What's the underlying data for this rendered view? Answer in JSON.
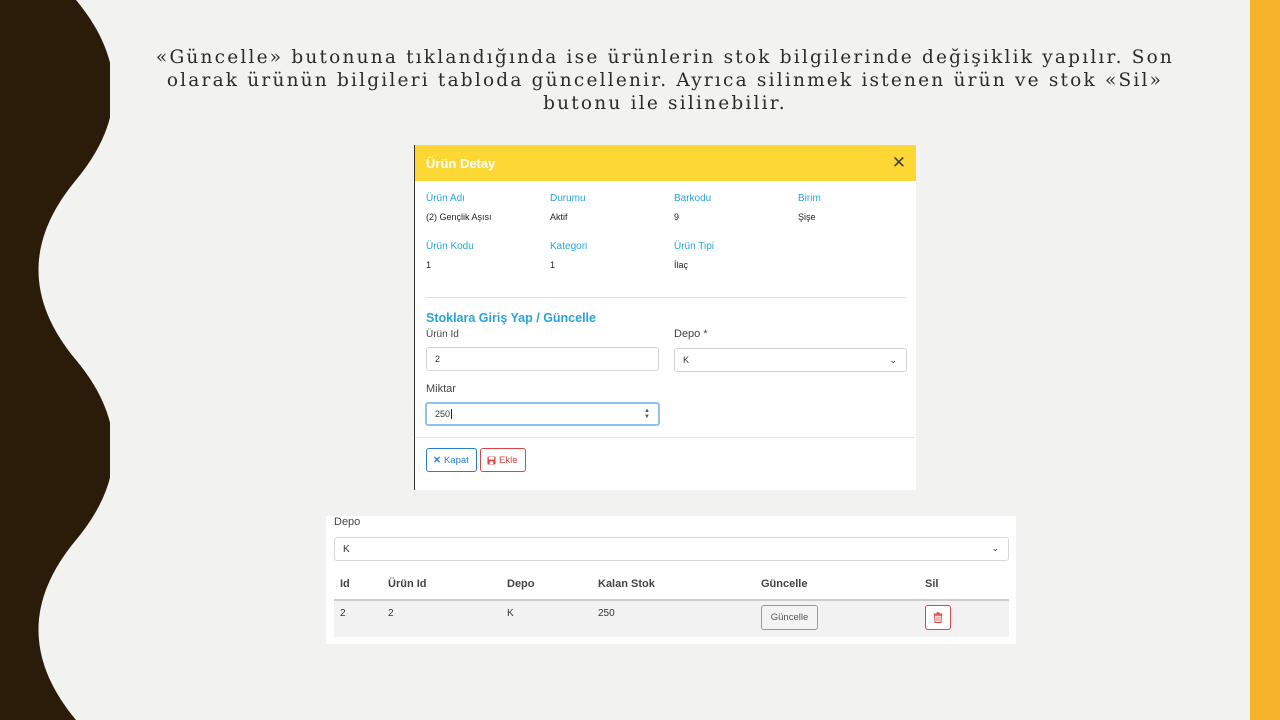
{
  "slide": {
    "text": "«Güncelle» butonuna tıklandığında ise ürünlerin stok bilgilerinde değişiklik yapılır. Son olarak ürünün bilgileri tabloda güncellenir. Ayrıca silinmek istenen ürün ve stok «Sil» butonu ile silinebilir.",
    "colors": {
      "wave": "#2a1c08",
      "right_band": "#f6b22a",
      "background": "#f2f2f0"
    }
  },
  "modal": {
    "title": "Ürün Detay",
    "header_color": "#fdd835",
    "details": [
      {
        "label": "Ürün Adı",
        "value": "(2) Gençlik Aşısı"
      },
      {
        "label": "Durumu",
        "value": "Aktif"
      },
      {
        "label": "Barkodu",
        "value": "9"
      },
      {
        "label": "Birim",
        "value": "Şişe"
      },
      {
        "label": "Ürün Kodu",
        "value": "1"
      },
      {
        "label": "Kategori",
        "value": "1"
      },
      {
        "label": "Ürün Tipi",
        "value": "İlaç"
      }
    ],
    "section_title": "Stoklara Giriş Yap / Güncelle",
    "urun_id_label": "Ürün Id",
    "urun_id_value": "2",
    "depo_label": "Depo *",
    "depo_value": "K",
    "miktar_label": "Miktar",
    "miktar_value": "250",
    "kapat_label": "Kapat",
    "ekle_label": "Ekle"
  },
  "stock_panel": {
    "depo_label": "Depo",
    "depo_value": "K",
    "columns": [
      "Id",
      "Ürün Id",
      "Depo",
      "Kalan Stok",
      "Güncelle",
      "Sil"
    ],
    "rows": [
      {
        "id": "2",
        "urun_id": "2",
        "depo": "K",
        "kalan_stok": "250",
        "guncelle_label": "Güncelle"
      }
    ]
  }
}
